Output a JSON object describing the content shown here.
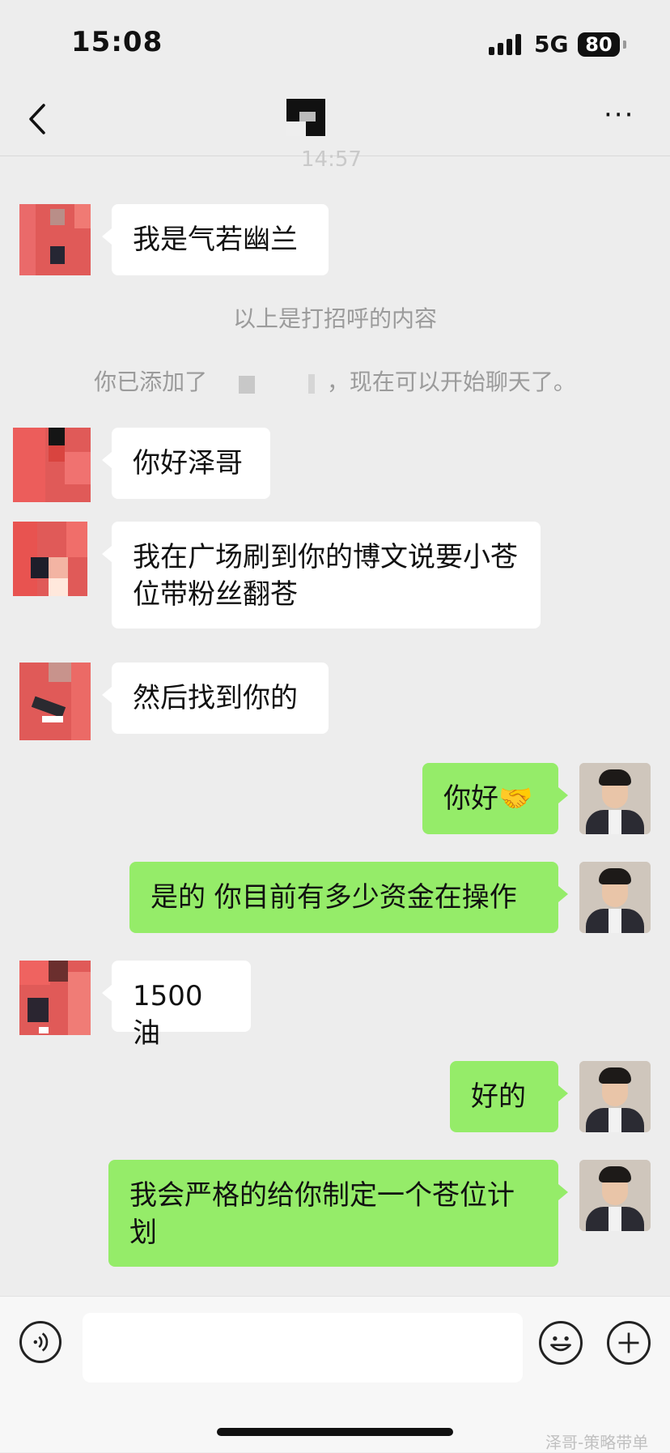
{
  "status_bar": {
    "time": "15:08",
    "network": "5G",
    "battery": "80"
  },
  "nav": {
    "more_label": "···"
  },
  "faded_time": "14:57",
  "notices": {
    "greeting": "以上是打招呼的内容",
    "added_prefix": "你已添加了",
    "added_suffix": "，现在可以开始聊天了。"
  },
  "messages": [
    {
      "side": "left",
      "text": "我是气若幽兰"
    },
    {
      "side": "left",
      "text": "你好泽哥"
    },
    {
      "side": "left",
      "text": "我在广场刷到你的博文说要小苍位带粉丝翻苍"
    },
    {
      "side": "left",
      "text": "然后找到你的"
    },
    {
      "side": "right",
      "text": "你好🤝"
    },
    {
      "side": "right",
      "text": "是的 你目前有多少资金在操作"
    },
    {
      "side": "left",
      "text": "1500油"
    },
    {
      "side": "right",
      "text": "好的"
    },
    {
      "side": "right",
      "text": "我会严格的给你制定一个苍位计划"
    }
  ],
  "input_bar": {
    "placeholder": ""
  },
  "watermark": "泽哥-策略带单",
  "icons": [
    "back-icon",
    "more-icon",
    "voice-icon",
    "emoji-icon",
    "plus-icon"
  ]
}
